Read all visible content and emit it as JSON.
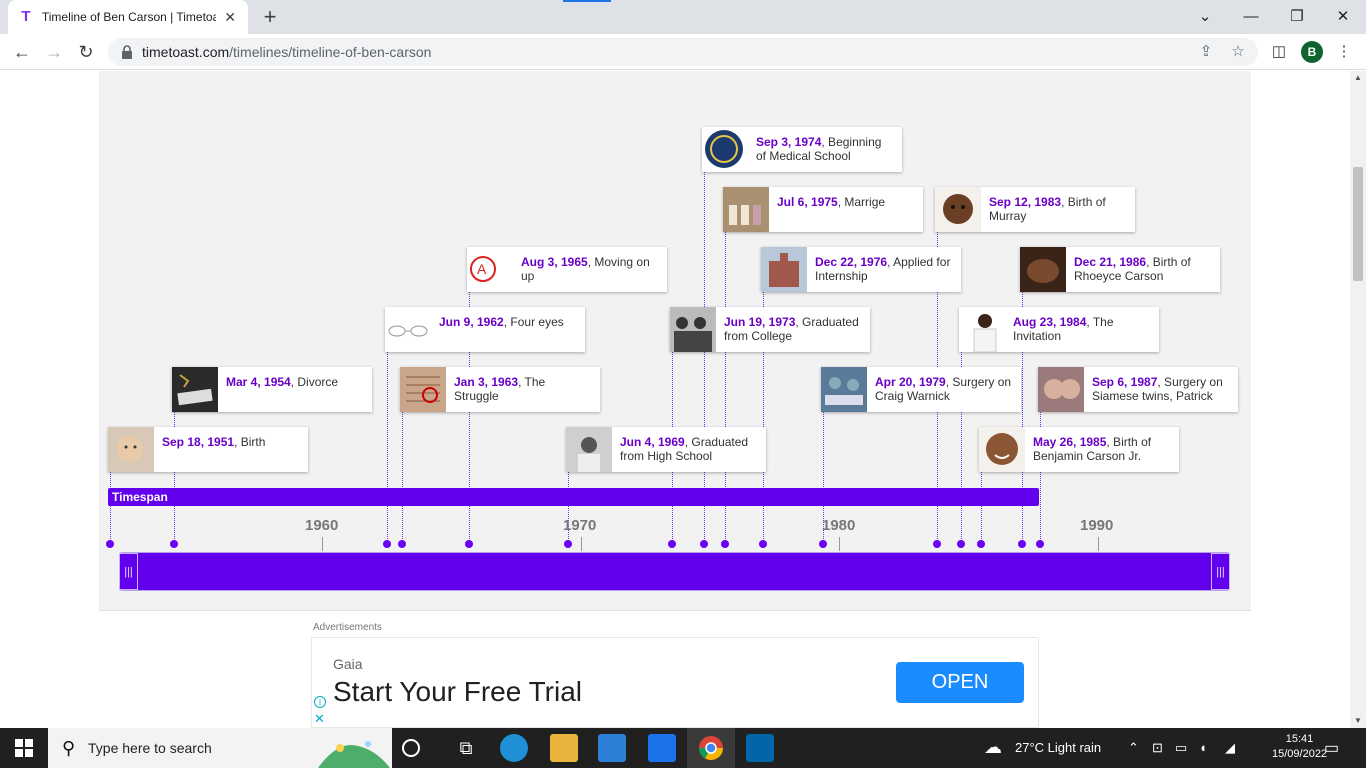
{
  "browser": {
    "tab_title": "Timeline of Ben Carson | Timetoast",
    "url_host": "timetoast.com",
    "url_path": "/timelines/timeline-of-ben-carson",
    "profile_initial": "B"
  },
  "timeline": {
    "events": [
      {
        "date": "Sep 18, 1951",
        "title": ", Birth"
      },
      {
        "date": "Mar 4, 1954",
        "title": ", Divorce"
      },
      {
        "date": "Jun 9, 1962",
        "title": ", Four eyes"
      },
      {
        "date": "Jan 3, 1963",
        "title": ", The Struggle"
      },
      {
        "date": "Aug 3, 1965",
        "title": ", Moving on up"
      },
      {
        "date": "Jun 4, 1969",
        "title": ", Graduated from High School"
      },
      {
        "date": "Jun 19, 1973",
        "title": ", Graduated from College"
      },
      {
        "date": "Sep 3, 1974",
        "title": ", Beginning of Medical School"
      },
      {
        "date": "Jul 6, 1975",
        "title": ", Marrige"
      },
      {
        "date": "Dec 22, 1976",
        "title": ", Applied for Internship"
      },
      {
        "date": "Apr 20, 1979",
        "title": ", Surgery on Craig Warnick"
      },
      {
        "date": "Sep 12, 1983",
        "title": ", Birth of Murray"
      },
      {
        "date": "Aug 23, 1984",
        "title": ", The Invitation"
      },
      {
        "date": "May 26, 1985",
        "title": ", Birth of Benjamin Carson Jr."
      },
      {
        "date": "Dec 21, 1986",
        "title": ", Birth of Rhoeyce Carson"
      },
      {
        "date": "Sep 6, 1987",
        "title": ", Surgery on Siamese twins, Patrick"
      }
    ],
    "timespan_label": "Timespan",
    "decades": [
      "1960",
      "1970",
      "1980",
      "1990"
    ],
    "accent_color": "#6200ee"
  },
  "ad": {
    "label": "Advertisements",
    "brand": "Gaia",
    "headline": "Start Your Free Trial",
    "cta": "OPEN"
  },
  "taskbar": {
    "search_placeholder": "Type here to search",
    "weather": "27°C  Light rain",
    "time": "15:41",
    "date": "15/09/2022"
  }
}
